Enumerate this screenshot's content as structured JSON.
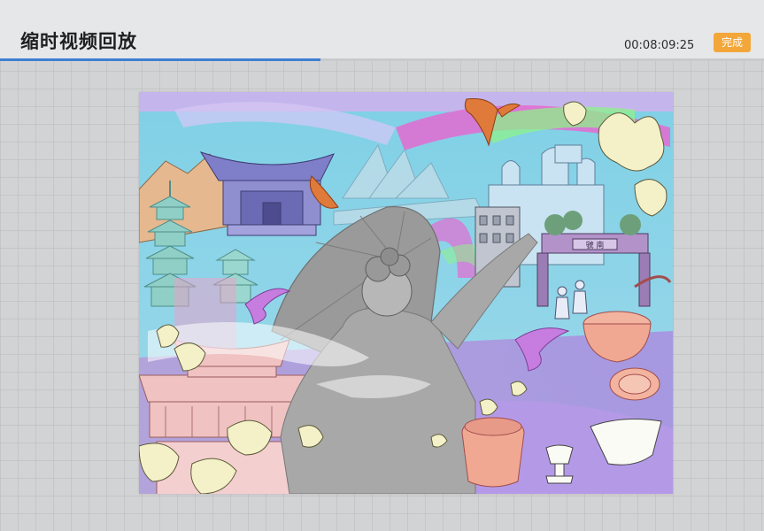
{
  "header": {
    "title": "缩时视频回放",
    "timecode": "00:08:09:25",
    "done_label": "完成"
  },
  "playback": {
    "progress_percent": 42
  },
  "canvas": {
    "sign_text": "虢 南"
  },
  "colors": {
    "accent_orange": "#f3a73a",
    "progress_blue": "#3d7fd4"
  }
}
